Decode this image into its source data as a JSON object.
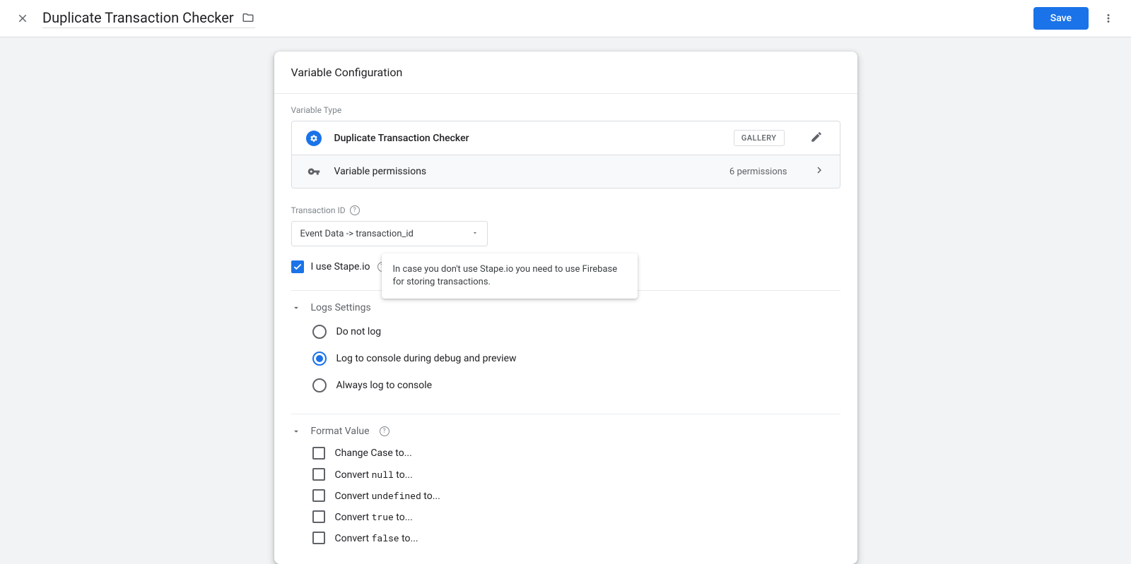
{
  "header": {
    "title": "Duplicate Transaction Checker",
    "save_label": "Save"
  },
  "card": {
    "title": "Variable Configuration",
    "variable_type_label": "Variable Type",
    "type_name": "Duplicate Transaction Checker",
    "gallery_label": "GALLERY",
    "permissions_label": "Variable permissions",
    "permissions_count": "6 permissions",
    "transaction_id_label": "Transaction ID",
    "transaction_id_value": "Event Data -> transaction_id",
    "stape_checkbox_label": "I use Stape.io",
    "tooltip_text": "In case you don't use Stape.io you need to use Firebase for storing transactions.",
    "logs_section_label": "Logs Settings",
    "radios": [
      {
        "label": "Do not log",
        "selected": false
      },
      {
        "label": "Log to console during debug and preview",
        "selected": true
      },
      {
        "label": "Always log to console",
        "selected": false
      }
    ],
    "format_section_label": "Format Value",
    "format_options": [
      {
        "pre": "Change Case to...",
        "mono": ""
      },
      {
        "pre": "Convert ",
        "mono": "null",
        "post": " to..."
      },
      {
        "pre": "Convert ",
        "mono": "undefined",
        "post": " to..."
      },
      {
        "pre": "Convert ",
        "mono": "true",
        "post": " to..."
      },
      {
        "pre": "Convert ",
        "mono": "false",
        "post": " to..."
      }
    ]
  }
}
